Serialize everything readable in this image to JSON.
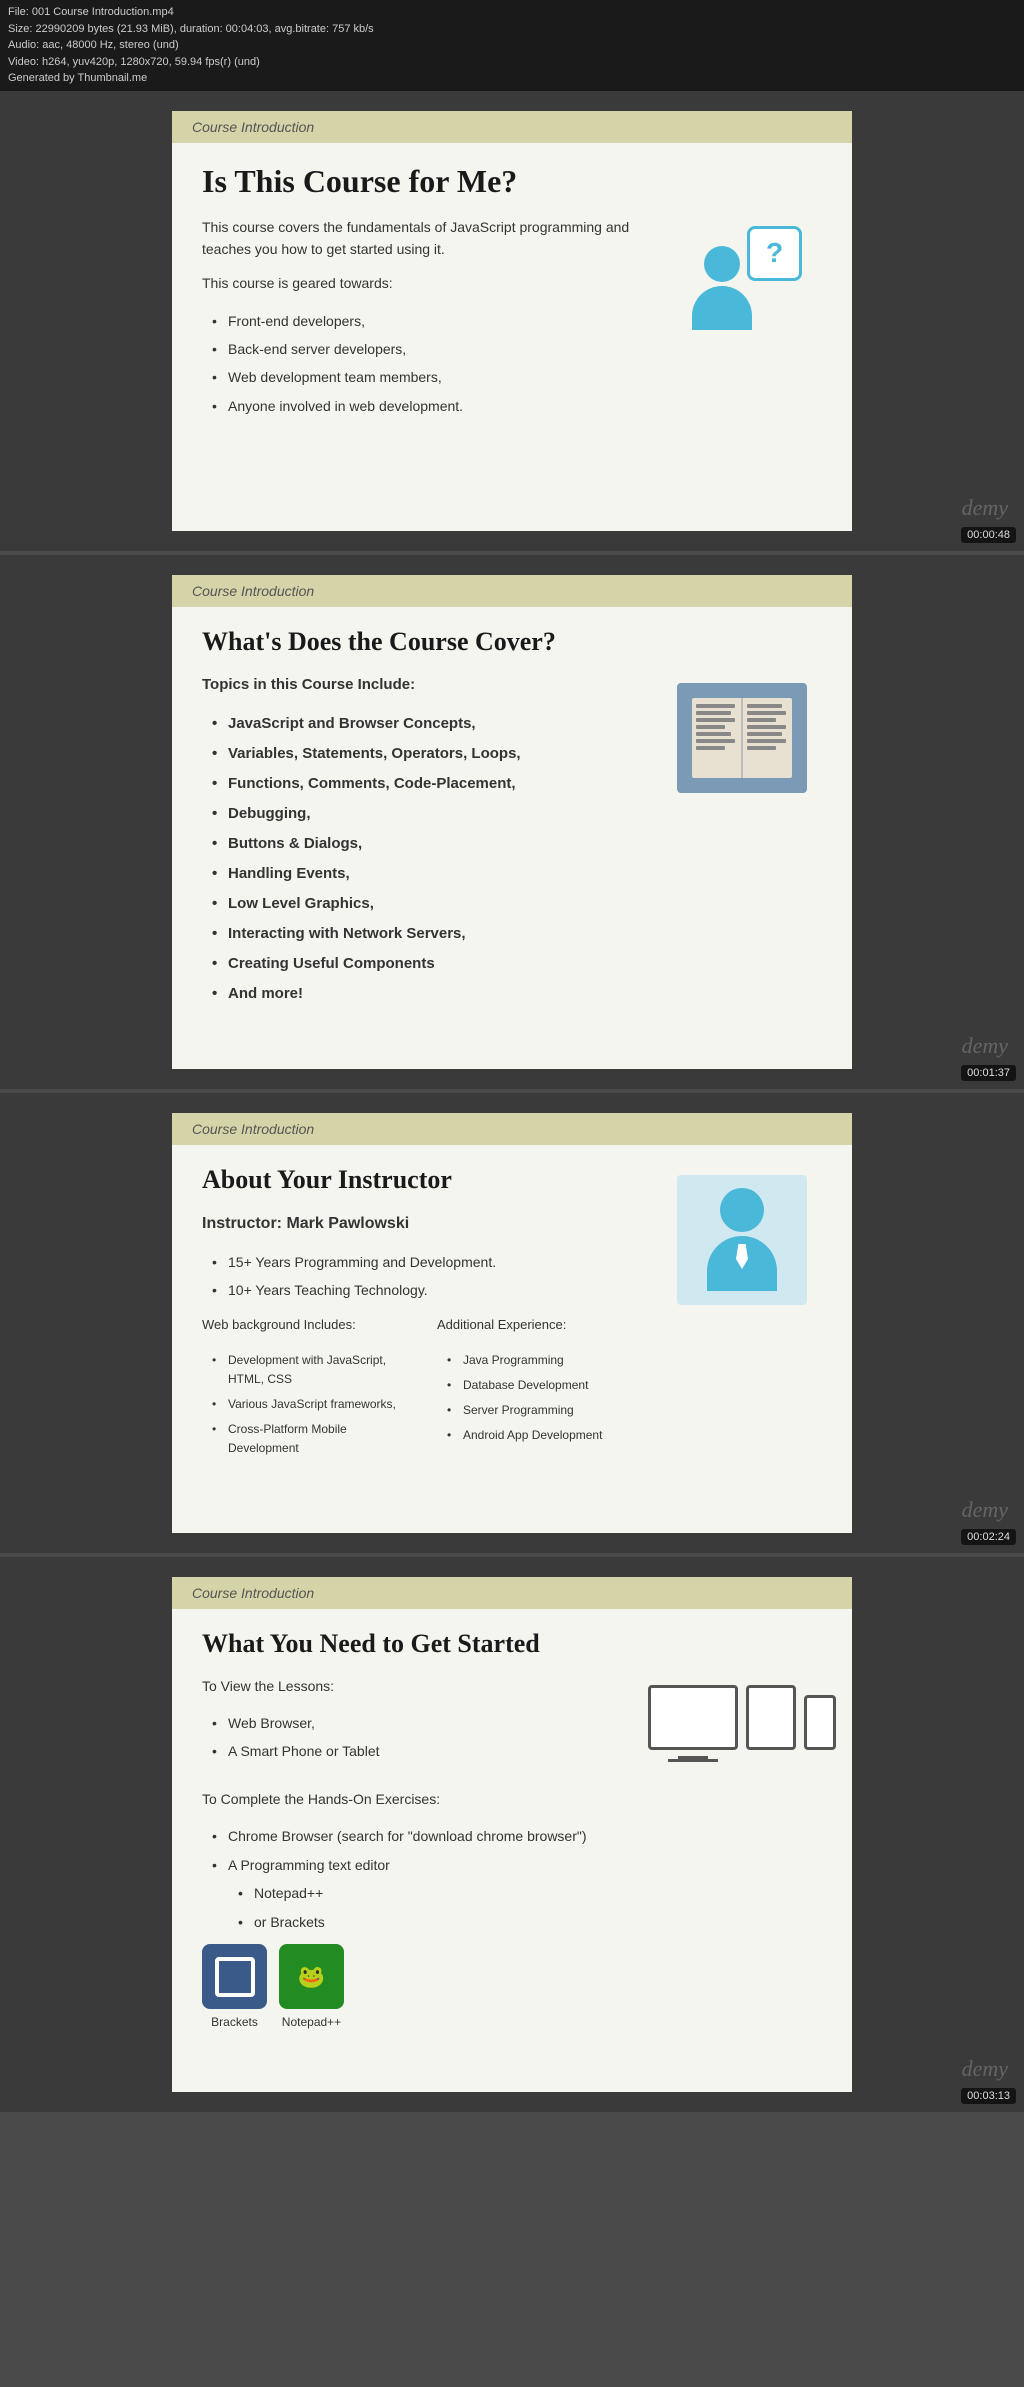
{
  "videoInfo": {
    "line1": "File: 001 Course Introduction.mp4",
    "line2": "Size: 22990209 bytes (21.93 MiB), duration: 00:04:03, avg.bitrate: 757 kb/s",
    "line3": "Audio: aac, 48000 Hz, stereo (und)",
    "line4": "Video: h264, yuv420p, 1280x720, 59.94 fps(r) (und)",
    "line5": "Generated by Thumbnail.me"
  },
  "slides": [
    {
      "header": "Course Introduction",
      "title": "Is This Course for Me?",
      "bodyParagraph1": "This course covers the fundamentals of JavaScript programming and teaches you how to get started using it.",
      "bodyParagraph2": "This course is geared towards:",
      "bullets": [
        "Front-end developers,",
        "Back-end server developers,",
        "Web development team members,",
        "Anyone involved in web development."
      ],
      "timestamp": "00:00:48",
      "watermark": "demy"
    },
    {
      "header": "Course Introduction",
      "title": "What's Does the Course Cover?",
      "boldHeading": "Topics in this Course Include:",
      "bullets": [
        "JavaScript and Browser Concepts,",
        "Variables, Statements, Operators, Loops,",
        "Functions, Comments, Code-Placement,",
        "Debugging,",
        "Buttons & Dialogs,",
        "Handling Events,",
        "Low Level Graphics,",
        "Interacting with Network Servers,",
        "Creating Useful Components",
        "And more!"
      ],
      "timestamp": "00:01:37",
      "watermark": "demy"
    },
    {
      "header": "Course Introduction",
      "title": "About Your Instructor",
      "instructorLabel": "Instructor: Mark Pawlowski",
      "bullets_main": [
        "15+ Years Programming and Development.",
        "10+ Years Teaching Technology."
      ],
      "webBgHeading": "Web background Includes:",
      "webBgBullets": [
        "Development with JavaScript, HTML, CSS",
        "Various JavaScript frameworks,",
        "Cross-Platform Mobile Development"
      ],
      "additionalHeading": "Additional Experience:",
      "additionalBullets": [
        "Java Programming",
        "Database Development",
        "Server Programming",
        "Android App Development"
      ],
      "timestamp": "00:02:24",
      "watermark": "demy"
    },
    {
      "header": "Course Introduction",
      "title": "What You Need to Get Started",
      "viewHeading": "To View the Lessons:",
      "viewBullets": [
        "Web Browser,",
        "A Smart Phone or Tablet"
      ],
      "completeHeading": "To Complete the Hands-On Exercises:",
      "completeBullets": [
        "Chrome Browser (search for \"download chrome browser\")",
        "A Programming text editor"
      ],
      "subBullets": [
        "Notepad++",
        "or Brackets"
      ],
      "bracketsLabel": "Brackets",
      "notepadLabel": "Notepad++",
      "timestamp": "00:03:13",
      "watermark": "demy"
    }
  ]
}
